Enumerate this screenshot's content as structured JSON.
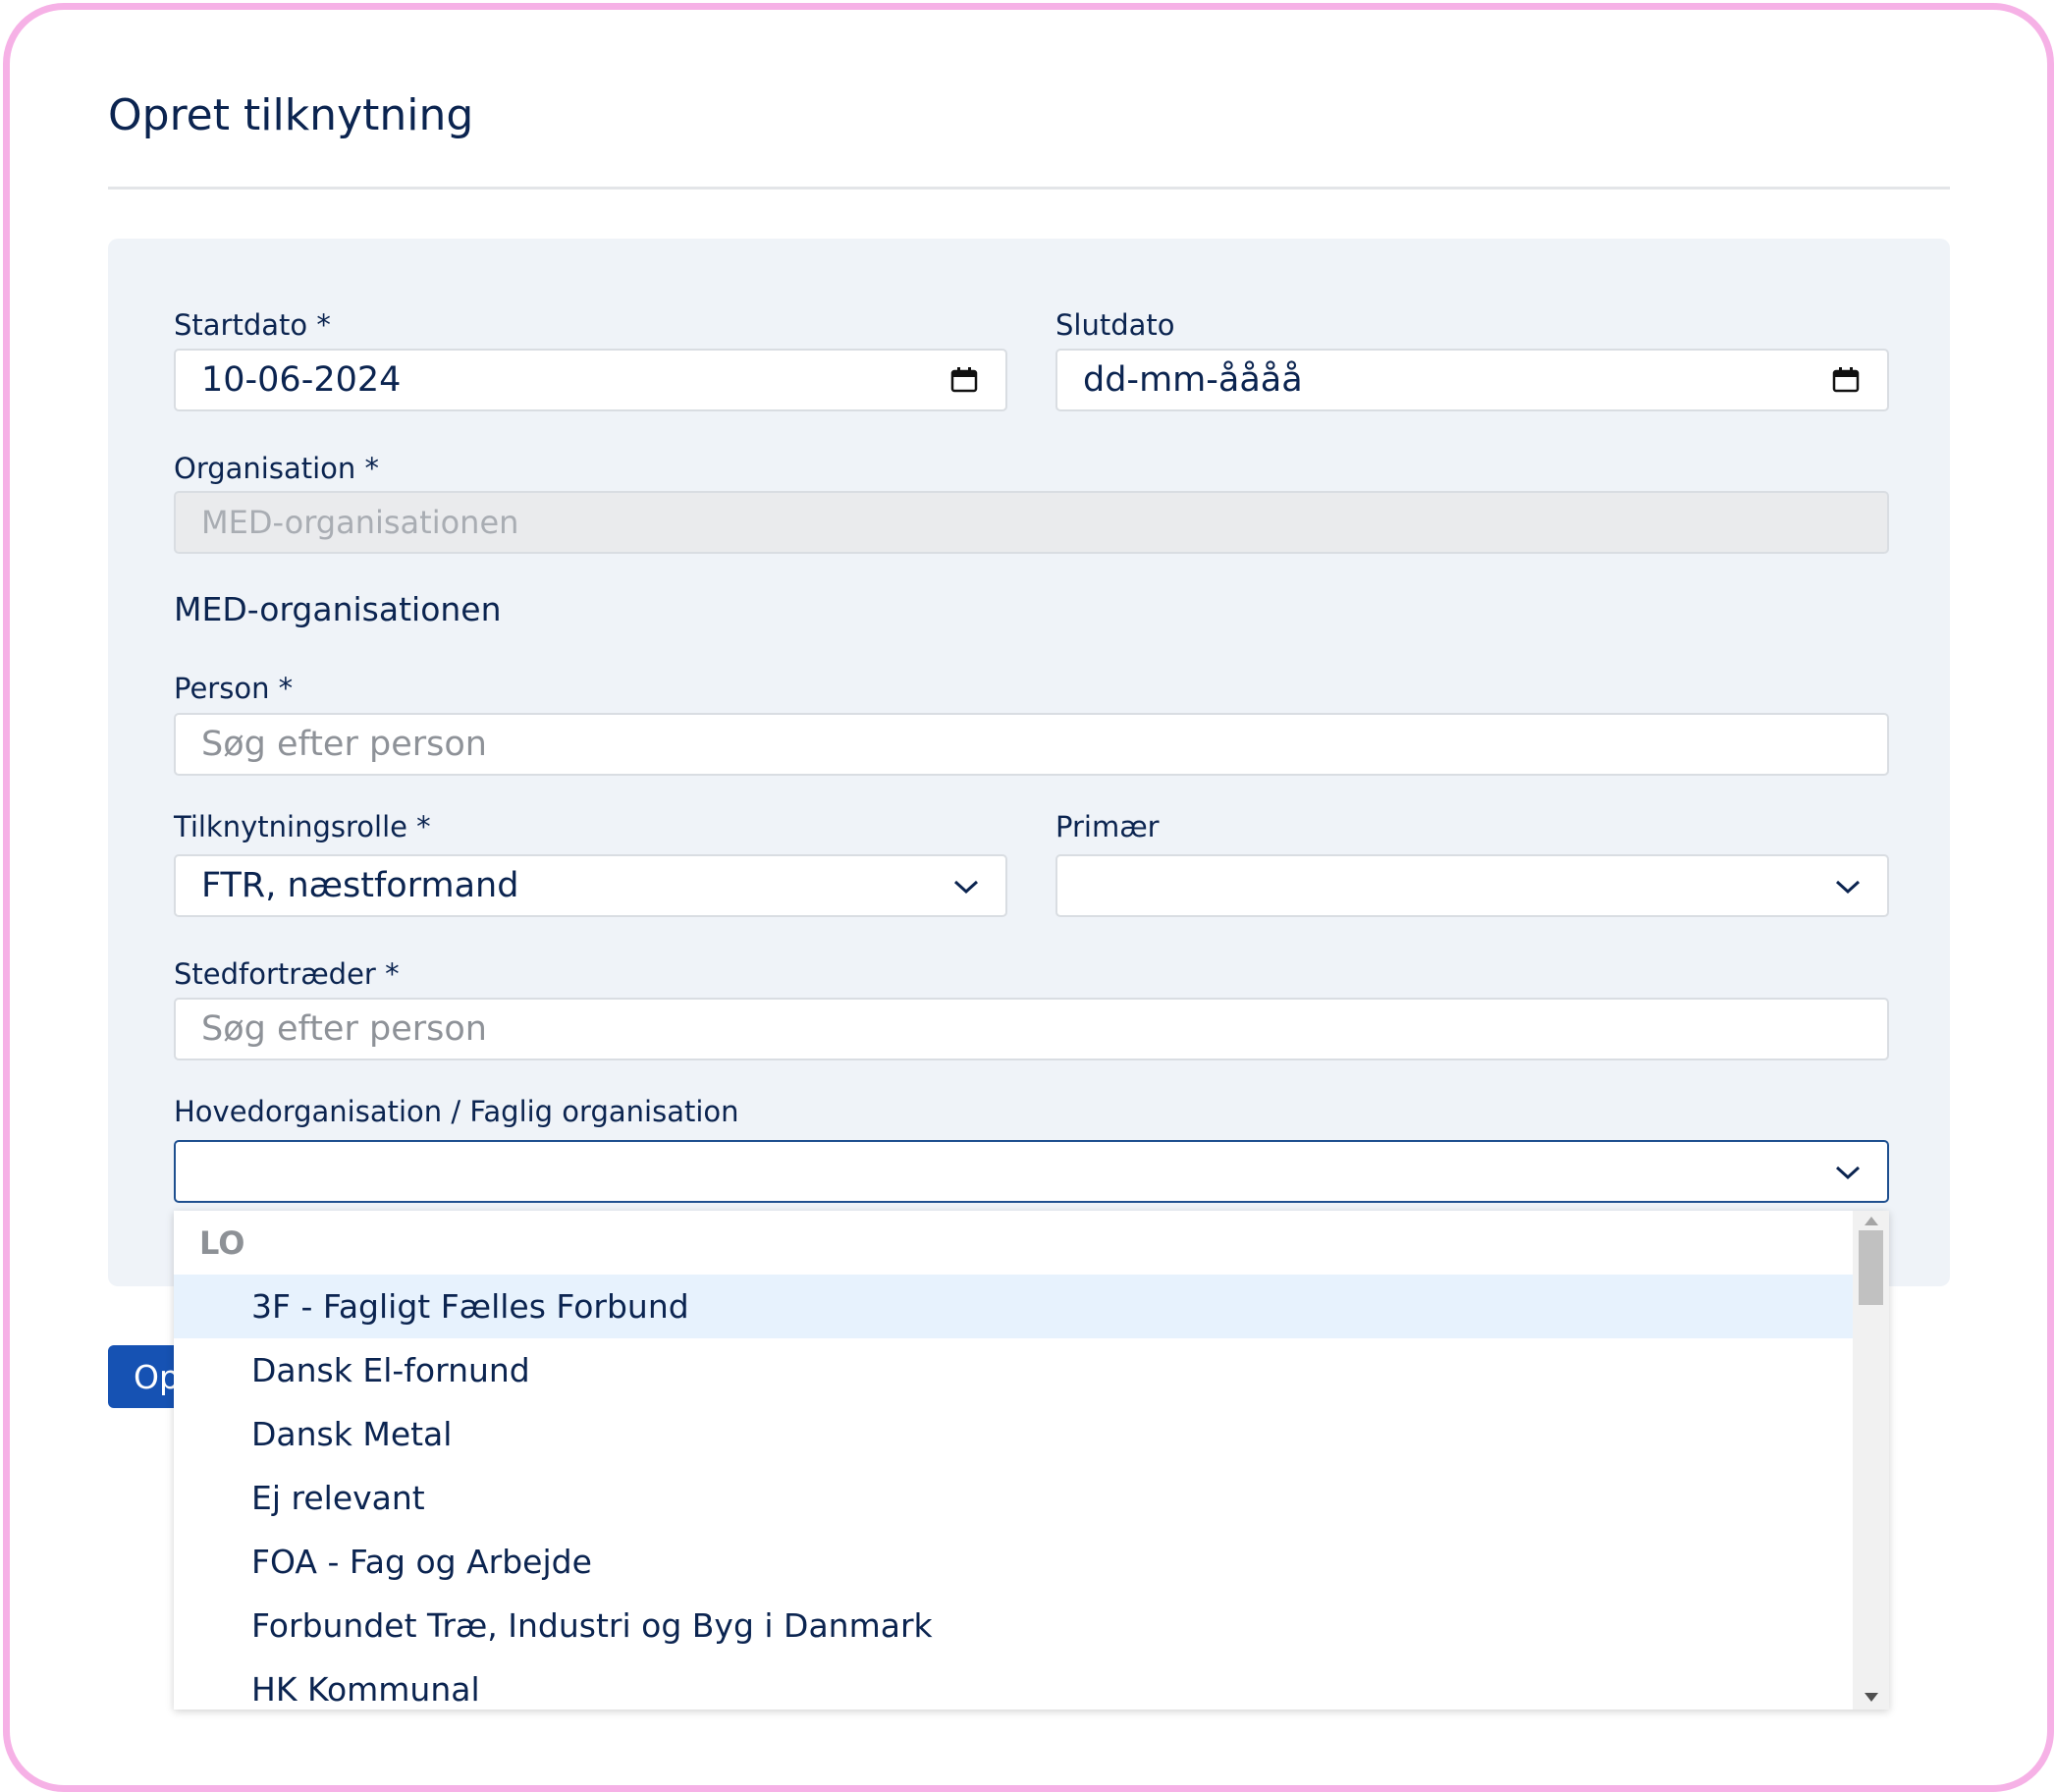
{
  "title": "Opret tilknytning",
  "form": {
    "startdato": {
      "label": "Startdato *",
      "value": "10-06-2024"
    },
    "slutdato": {
      "label": "Slutdato",
      "value": "dd-mm-åååå"
    },
    "organisation": {
      "label": "Organisation *",
      "value": "MED-organisationen"
    },
    "organisation_text": "MED-organisationen",
    "person": {
      "label": "Person *",
      "placeholder": "Søg efter person"
    },
    "tilknytningsrolle": {
      "label": "Tilknytningsrolle *",
      "value": "FTR, næstformand"
    },
    "primaer": {
      "label": "Primær",
      "value": ""
    },
    "stedfortraeder": {
      "label": "Stedfortræder *",
      "placeholder": "Søg efter person"
    },
    "hovedorganisation": {
      "label": "Hovedorganisation / Faglig organisation",
      "value": ""
    }
  },
  "submit_label": "Op",
  "dropdown": {
    "group": "LO",
    "items": [
      "3F - Fagligt Fælles Forbund",
      "Dansk El-fornund",
      "Dansk Metal",
      "Ej relevant",
      "FOA - Fag og Arbejde",
      "Forbundet Træ, Industri og Byg i Danmark",
      "HK Kommunal"
    ],
    "highlighted_index": 0
  },
  "colors": {
    "frame": "#f6b1e6",
    "text": "#0b2450",
    "panel": "#eff3f8",
    "button": "#1652b3",
    "highlight": "#e7f2fd"
  }
}
